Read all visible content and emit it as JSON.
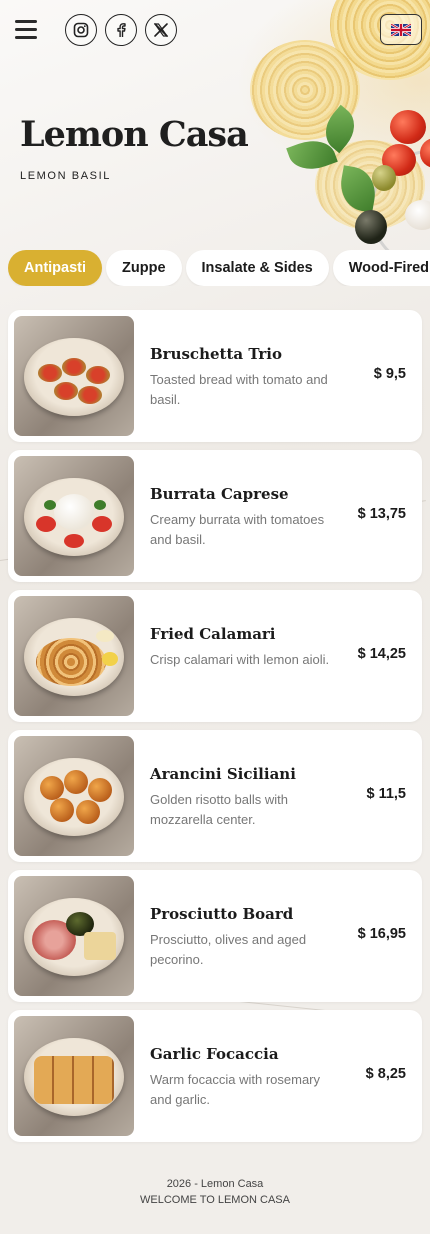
{
  "header": {
    "menu_icon": "hamburger-icon",
    "social": [
      {
        "name": "instagram",
        "icon": "instagram-icon"
      },
      {
        "name": "facebook",
        "icon": "facebook-icon"
      },
      {
        "name": "x",
        "icon": "x-icon"
      }
    ],
    "language_icon": "uk-flag-icon"
  },
  "hero": {
    "title": "Lemon Casa",
    "subtitle": "LEMON BASIL"
  },
  "tabs": [
    {
      "label": "Antipasti",
      "active": true
    },
    {
      "label": "Zuppe",
      "active": false
    },
    {
      "label": "Insalate & Sides",
      "active": false
    },
    {
      "label": "Wood-Fired Piz",
      "active": false
    }
  ],
  "menu": [
    {
      "name": "Bruschetta Trio",
      "description": "Toasted bread with tomato and basil.",
      "price": "$ 9,5"
    },
    {
      "name": "Burrata Caprese",
      "description": "Creamy burrata with tomatoes and basil.",
      "price": "$ 13,75"
    },
    {
      "name": "Fried Calamari",
      "description": "Crisp calamari with lemon aioli.",
      "price": "$ 14,25"
    },
    {
      "name": "Arancini Siciliani",
      "description": "Golden risotto balls with mozzarella center.",
      "price": "$ 11,5"
    },
    {
      "name": "Prosciutto Board",
      "description": "Prosciutto, olives and aged pecorino.",
      "price": "$ 16,95"
    },
    {
      "name": "Garlic Focaccia",
      "description": "Warm focaccia with rosemary and garlic.",
      "price": "$ 8,25"
    }
  ],
  "footer": {
    "copyright": "2026 - Lemon Casa",
    "tagline": "WELCOME TO LEMON CASA"
  },
  "colors": {
    "accent": "#d9b031",
    "background": "#efebe6",
    "card": "#ffffff",
    "text": "#1b1b1b",
    "muted": "#777777"
  }
}
